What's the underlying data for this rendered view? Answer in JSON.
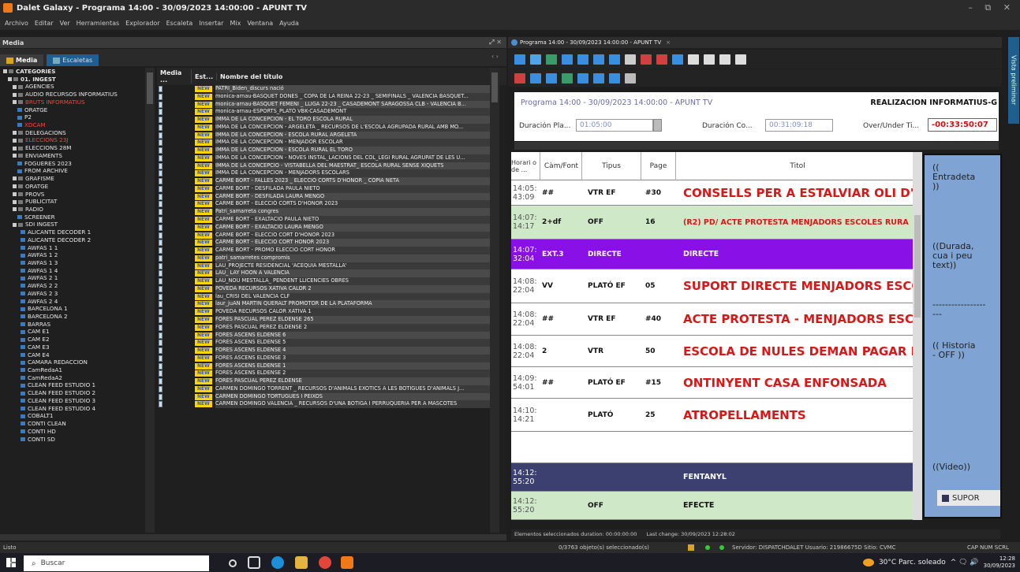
{
  "window": {
    "title": "Dalet Galaxy - Programa 14:00 - 30/09/2023 14:00:00 - APUNT TV",
    "controls": "– ⧉ ✕"
  },
  "menu": [
    "Archivo",
    "Editar",
    "Ver",
    "Herramientas",
    "Explorador",
    "Escaleta",
    "Insertar",
    "Mix",
    "Ventana",
    "Ayuda"
  ],
  "media_panel": {
    "title": "Media",
    "controls": "⤢ ✕",
    "tabs": [
      {
        "label": "Media",
        "active": true
      },
      {
        "label": "Escaletas",
        "active": false
      }
    ],
    "tab_nav": "‹ ›"
  },
  "tree": [
    {
      "label": "CATEGORIES",
      "level": 0,
      "expander": true
    },
    {
      "label": "01. INGEST",
      "level": 1,
      "expander": true
    },
    {
      "label": "AGENCIES",
      "level": 2,
      "expander": true
    },
    {
      "label": "AUDIO RECURSOS INFORMATIUS",
      "level": 2,
      "expander": true
    },
    {
      "label": "BRUTS INFORMATIUS",
      "level": 2,
      "expander": true,
      "selected": true
    },
    {
      "label": "ORATGE",
      "level": 3
    },
    {
      "label": "P2",
      "level": 3
    },
    {
      "label": "XDCAM",
      "level": 3,
      "selected": true
    },
    {
      "label": "DELEGACIONS",
      "level": 2,
      "expander": true
    },
    {
      "label": "ELECCIONS 23J",
      "level": 2,
      "expander": true,
      "selected": true
    },
    {
      "label": "ELECCIONS 28M",
      "level": 2,
      "expander": true
    },
    {
      "label": "ENVIAMENTS",
      "level": 2,
      "expander": true
    },
    {
      "label": "FOGUERES 2023",
      "level": 3
    },
    {
      "label": "FROM ARCHIVE",
      "level": 3
    },
    {
      "label": "GRAFISME",
      "level": 2,
      "expander": true
    },
    {
      "label": "ORATGE",
      "level": 2,
      "expander": true
    },
    {
      "label": "PROVS",
      "level": 2,
      "expander": true
    },
    {
      "label": "PUBLICITAT",
      "level": 2,
      "expander": true
    },
    {
      "label": "RADIO",
      "level": 2,
      "expander": true
    },
    {
      "label": "SCREENER",
      "level": 3
    },
    {
      "label": "SDI INGEST",
      "level": 2,
      "expander": true
    },
    {
      "label": "ALICANTE DECODER 1",
      "level": 4
    },
    {
      "label": "ALICANTE DECODER 2",
      "level": 4
    },
    {
      "label": "AWFAS 1 1",
      "level": 4
    },
    {
      "label": "AWFAS 1 2",
      "level": 4
    },
    {
      "label": "AWFAS 1 3",
      "level": 4
    },
    {
      "label": "AWFAS 1 4",
      "level": 4
    },
    {
      "label": "AWFAS 2 1",
      "level": 4
    },
    {
      "label": "AWFAS 2 2",
      "level": 4
    },
    {
      "label": "AWFAS 2 3",
      "level": 4
    },
    {
      "label": "AWFAS 2 4",
      "level": 4
    },
    {
      "label": "BARCELONA 1",
      "level": 4
    },
    {
      "label": "BARCELONA 2",
      "level": 4
    },
    {
      "label": "BARRAS",
      "level": 4
    },
    {
      "label": "CAM E1",
      "level": 4
    },
    {
      "label": "CAM E2",
      "level": 4
    },
    {
      "label": "CAM E3",
      "level": 4
    },
    {
      "label": "CAM E4",
      "level": 4
    },
    {
      "label": "CAMARA REDACCION",
      "level": 4
    },
    {
      "label": "CamRedaA1",
      "level": 4
    },
    {
      "label": "CamRedaA2",
      "level": 4
    },
    {
      "label": "CLEAN FEED ESTUDIO 1",
      "level": 4
    },
    {
      "label": "CLEAN FEED ESTUDIO 2",
      "level": 4
    },
    {
      "label": "CLEAN FEED ESTUDIO 3",
      "level": 4
    },
    {
      "label": "CLEAN FEED ESTUDIO 4",
      "level": 4
    },
    {
      "label": "COBALT1",
      "level": 4
    },
    {
      "label": "CONTI CLEAN",
      "level": 4
    },
    {
      "label": "CONTI HD",
      "level": 4
    },
    {
      "label": "CONTI SD",
      "level": 4
    }
  ],
  "grid": {
    "headers": [
      "Media ...",
      "Est...",
      "Nombre del título"
    ],
    "badge": "NEW",
    "rows": [
      "PATRI_Biden_discurs nació",
      "monica-arnau-BASQUET DONES _ COPA DE LA REINA 22-23 _ SEMIFINALS _ VALENCIA BASQUET...",
      "monica-arnau-BASQUET FEMENI _ LLIGA 22-23 _ CASADEMONT SARAGOSSA CLB - VALENCIA B...",
      "monica-arnau-ESPORTS_PLATÓ VBK-CASADEMONT",
      "IMMA DE LA CONCEPCION - EL TORO ESCOLA RURAL",
      "IMMA DE LA CONCEPCION - ARGELETA _ RECURSOS DE L'ESCOLA AGRUPADA RURAL AMB MO...",
      "IMMA DE LA CONCEPCION - ESCOLA RURAL ARGELETA",
      "IMMA DE LA CONCEPCION - MENJADOR ESCOLAR",
      "IMMA DE LA CONCEPCION - ESCOLA RURAL EL TORO",
      "IMMA DE LA CONCEPCION - NOVES INSTAL_LACIONS DEL COL_LEGI RURAL AGRUPAT DE LES U...",
      "IMMA DE LA CONCEPCIO - VISTABELLA DEL MAESTRAT_ ESCOLA RURAL SENSE XIQUETS",
      "IMMA DE LA CONCEPCION - MENJADORS ESCOLARS",
      "CARME BORT - FALLES 2023 _ ELECCIÓ CORTS D'HONOR _ COPIA NETA",
      "CARME BORT - DESFILADA PAULA NIETO",
      "CARME BORT - DESFILADA LAURA MENGO",
      "CARME BORT - ELECCIÓ CORTS D'HONOR 2023",
      "Patri_samarreta congres",
      "CARME BORT - EXALTACIO PAULA NIETO",
      "CARME BORT - EXALTACIO LAURA MENGO",
      "CARME BORT - ELECCIO CORT D'HONOR 2023",
      "CARME BORT - ELECCIO CORT HONOR 2023",
      "CARME BORT - PROMO ELECCIO CORT HONOR",
      "patri_samarretes compromís",
      "LAU_PROJECTE RESIDENCIAL 'ACEQUIA MESTALLA'",
      "LAU_ LAY HOON A VALENCIA",
      "LAU_NOU MESTALLA_ PENDENT LLICENCIES OBRES",
      "POVEDA RECURSOS XATIVA CALOR 2",
      "lau_CRISI DEL VALENCIA CLF",
      "laur_juAN MARTIN QUERALT PROMOTOR DE LA PLATAFORMA",
      "POVEDA RECURSOS CALOR XÀTIVA 1",
      "FORÉS PASCUAL PÉREZ ELDENSE 265",
      "FORÉS PASCUAL PÉREZ ELDENSE 2",
      "FORÉS ASCENS ELDENSE 6",
      "FORÉS ASCENS ELDENSE 5",
      "FORÉS ASCENS ELDENSE 4",
      "FORÉS ASCENS ELDENSE 3",
      "FORÉS ASCENS ELDENSE 1",
      "FORÉS ASCENS ELDENSE 2",
      "FORÉS PASCUAL PÉREZ ELDENSE",
      "CARMEN DOMINGO TORRENT _ RECURSOS D'ANIMALS EXOTICS A LES BOTIGUES D'ANIMALS J...",
      "CARMEN DOMINGO TORTUGUES I PEIXOS",
      "CARMEN DOMINGO VALENCIA _ RECURSOS D'UNA BOTIGA I PERRUQUERIA PER A MASCOTES"
    ]
  },
  "rundown_panel": {
    "tab_title": "Programa 14:00 - 30/09/2023 14:00:00 - APUNT TV",
    "tab_close": "×",
    "program_title": "Programa 14:00 - 30/09/2023 14:00:00 - APUNT TV",
    "realization": "REALIZACION INFORMATIUS-G",
    "dur_planned_label": "Duración Pla...",
    "dur_planned_value": "01:05:00",
    "dur_content_label": "Duración Co...",
    "dur_content_value": "00:31:09:18",
    "over_under_label": "Over/Under Ti...",
    "over_under_value": "-00:33:50:07",
    "columns": [
      "Horari o de ...",
      "Càm/Font",
      "Tipus",
      "Page",
      "Titol"
    ],
    "rows": [
      {
        "time": "14:05:\n43:09",
        "cam": "##",
        "tipus": "VTR EF",
        "page": "#30",
        "titol": "CONSELLS PER A ESTALVIAR OLI D'O",
        "style": "big",
        "bg": "#ffffff",
        "color": "#d81818"
      },
      {
        "time": "14:07:\n14:17",
        "cam": "2+df",
        "tipus": "OFF",
        "page": "16",
        "titol": "(R2) PD/ ACTE PROTESTA MENJADORS ESCOLES RURA",
        "style": "small",
        "bg": "#cfe9c8",
        "color": "#d81818"
      },
      {
        "time": "14:07:\n32:04",
        "cam": "EXT.3",
        "tipus": "DIRECTE",
        "page": "",
        "titol": "DIRECTE",
        "style": "small",
        "bg": "#8a10e8",
        "color": "#ffffff"
      },
      {
        "time": "14:08:\n22:04",
        "cam": "VV",
        "tipus": "PLATÓ EF",
        "page": "05",
        "titol": "SUPORT DIRECTE MENJADORS ESCO",
        "style": "big",
        "bg": "#ffffff",
        "color": "#d81818"
      },
      {
        "time": "14:08:\n22:04",
        "cam": "##",
        "tipus": "VTR EF",
        "page": "#40",
        "titol": "ACTE PROTESTA - MENJADORS ESCO",
        "style": "big",
        "bg": "#ffffff",
        "color": "#d81818"
      },
      {
        "time": "14:08:\n22:04",
        "cam": "2",
        "tipus": "VTR",
        "page": "50",
        "titol": "ESCOLA DE NULES DEMAN PAGAR M",
        "style": "big",
        "bg": "#ffffff",
        "color": "#d81818"
      },
      {
        "time": "14:09:\n54:01",
        "cam": "##",
        "tipus": "PLATÓ EF",
        "page": "#15",
        "titol": "ONTINYENT CASA ENFONSADA",
        "style": "big",
        "bg": "#ffffff",
        "color": "#d81818"
      },
      {
        "time": "14:10:\n14:21",
        "cam": "",
        "tipus": "PLATÓ",
        "page": "25",
        "titol": "ATROPELLAMENTS",
        "style": "big",
        "bg": "#ffffff",
        "color": "#d81818"
      },
      {
        "time": "",
        "cam": "",
        "tipus": "",
        "page": "",
        "titol": "",
        "style": "small",
        "bg": "#ffffff",
        "color": "#d81818"
      },
      {
        "time": "14:12:\n55:20",
        "cam": "",
        "tipus": "",
        "page": "",
        "titol": "FENTANYL",
        "style": "small",
        "bg": "#3b4070",
        "color": "#ffffff"
      },
      {
        "time": "14:12:\n55:20",
        "cam": "",
        "tipus": "OFF",
        "page": "",
        "titol": "EFECTE",
        "style": "small",
        "bg": "#cfe9c8",
        "color": "#111111"
      }
    ],
    "text_panel": [
      "((\nEntradeta\n))",
      "((Durada,\ncua i peu\ntext))",
      "-----------------\n---",
      "(( Historia\n- OFF ))",
      "((Video))"
    ],
    "supor_button": "SUPOR",
    "vista_previa": "Vista preliminar",
    "status_selected": "Elementos seleccionados duration: 00:00:00:00",
    "status_last_change": "Last change: 30/09/2023 12:28:02"
  },
  "statusbar": {
    "left": "Listo",
    "objects": "0/3763 objeto(s) seleccionado(s)",
    "server": "Servidor: DISPATCHDALET Usuario: 21986675D Sitio: CVMC",
    "keys": "CAP NUM SCRL"
  },
  "taskbar": {
    "search_placeholder": "Buscar",
    "weather": "30°C Parc. soleado",
    "time": "12:28",
    "date": "30/09/2023",
    "tray": "^ 🗨 🔊"
  }
}
